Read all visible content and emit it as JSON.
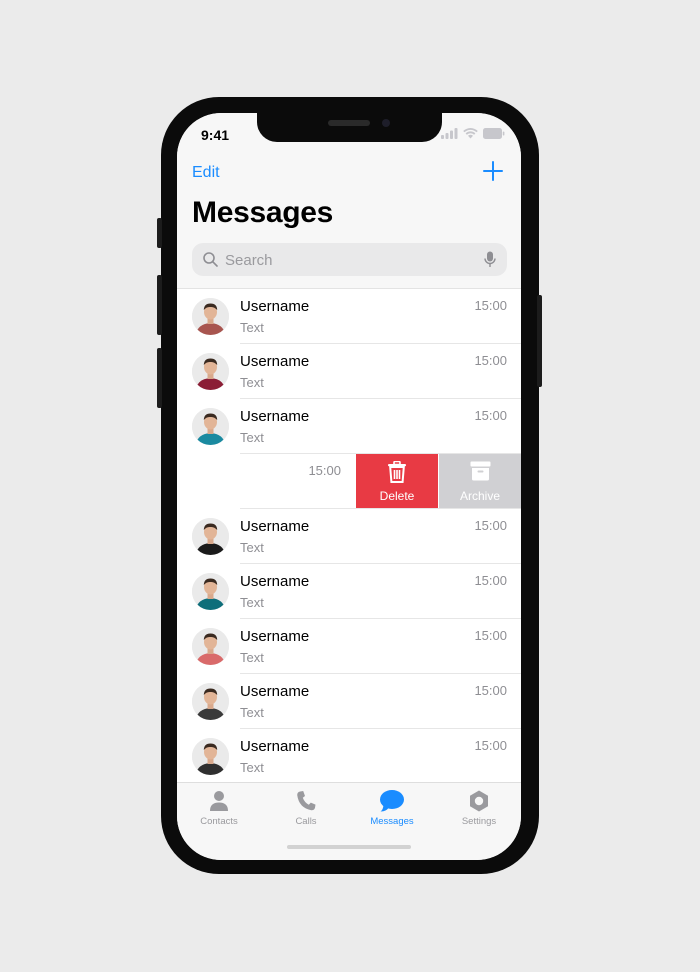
{
  "status": {
    "time": "9:41"
  },
  "header": {
    "edit_label": "Edit",
    "title": "Messages"
  },
  "search": {
    "placeholder": "Search"
  },
  "conversations": [
    {
      "username": "Username",
      "preview": "Text",
      "time": "15:00",
      "avatar_shirt": "#a8554f",
      "avatar_bg": "#eaeaea"
    },
    {
      "username": "Username",
      "preview": "Text",
      "time": "15:00",
      "avatar_shirt": "#8b1e36",
      "avatar_bg": "#eaeaea"
    },
    {
      "username": "Username",
      "preview": "Text",
      "time": "15:00",
      "avatar_shirt": "#1a8aa0",
      "avatar_bg": "#eaeaea"
    },
    {
      "username": "Username",
      "preview": "Text",
      "time": "15:00",
      "avatar_shirt": "#1b1b1b",
      "avatar_bg": "#eaeaea"
    },
    {
      "username": "Username",
      "preview": "Text",
      "time": "15:00",
      "avatar_shirt": "#0e6e7a",
      "avatar_bg": "#eaeaea"
    },
    {
      "username": "Username",
      "preview": "Text",
      "time": "15:00",
      "avatar_shirt": "#d96a6a",
      "avatar_bg": "#eaeaea"
    },
    {
      "username": "Username",
      "preview": "Text",
      "time": "15:00",
      "avatar_shirt": "#3a3a3a",
      "avatar_bg": "#eaeaea"
    },
    {
      "username": "Username",
      "preview": "Text",
      "time": "15:00",
      "avatar_shirt": "#2f2f2f",
      "avatar_bg": "#eaeaea"
    }
  ],
  "swiped_row": {
    "time": "15:00",
    "delete_label": "Delete",
    "archive_label": "Archive"
  },
  "tabs": [
    {
      "label": "Contacts",
      "icon": "person-icon",
      "active": false
    },
    {
      "label": "Calls",
      "icon": "phone-icon",
      "active": false
    },
    {
      "label": "Messages",
      "icon": "chat-bubble-icon",
      "active": true
    },
    {
      "label": "Settings",
      "icon": "gear-icon",
      "active": false
    }
  ],
  "colors": {
    "accent": "#1a8cff",
    "delete": "#e83a44",
    "archive": "#d0d0d3",
    "muted": "#8e8e93"
  }
}
